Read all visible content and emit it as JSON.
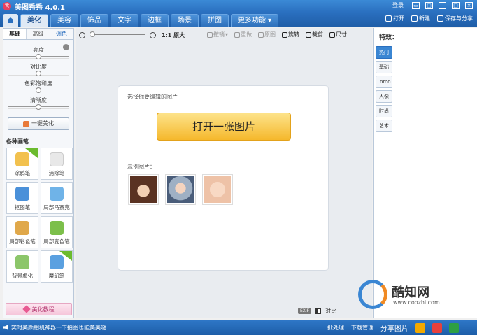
{
  "app": {
    "title": "美图秀秀 4.0.1",
    "logo_text": "秀",
    "login": "登录"
  },
  "menu": {
    "tabs": [
      "美化",
      "美容",
      "饰品",
      "文字",
      "边框",
      "场景",
      "拼图",
      "更多功能"
    ],
    "active": "美化",
    "open": "打开",
    "new": "新建",
    "save_share": "保存与分享"
  },
  "left_panel": {
    "tabs": [
      "基础",
      "高级",
      "调色"
    ],
    "sliders": [
      {
        "label": "亮度",
        "value": 0.5
      },
      {
        "label": "对比度",
        "value": 0.5
      },
      {
        "label": "色彩饱和度",
        "value": 0.5
      },
      {
        "label": "清晰度",
        "value": 0.5
      }
    ],
    "one_key": "一键美化",
    "brushes_title": "各种画笔",
    "tools": [
      "涂鸦笔",
      "消除笔",
      "抠图笔",
      "局部马赛克",
      "局部彩色笔",
      "局部变色笔",
      "背景虚化",
      "魔幻笔"
    ],
    "tutorial": "美化教程"
  },
  "toolbar": {
    "zoom_value": 0.0,
    "orig_ratio": "1:1",
    "orig_label": "原大",
    "undo": "撤销",
    "redo": "重做",
    "reset": "原图",
    "rotate": "旋转",
    "crop": "裁剪",
    "size": "尺寸"
  },
  "canvas": {
    "hint": "选择你要编辑的图片",
    "open_button": "打开一张图片",
    "sample_label": "示例图片："
  },
  "bottom": {
    "exif": "EXIF",
    "compare": "对比"
  },
  "right_panel": {
    "title": "特效：",
    "tabs": [
      "热门",
      "基础",
      "Lomo",
      "人像",
      "时尚",
      "艺术"
    ]
  },
  "watermark": {
    "brand": "酷知网",
    "url": "www.coozhi.com"
  },
  "status": {
    "message": "实时美颜相机神器一下拍图也能美美哒",
    "batch": "批处理",
    "download": "下载管理",
    "share": "分享图片"
  },
  "colors": {
    "primary": "#2a6fbf",
    "open_button": "#f5b82c",
    "status_bar": "#1d5ea8"
  }
}
